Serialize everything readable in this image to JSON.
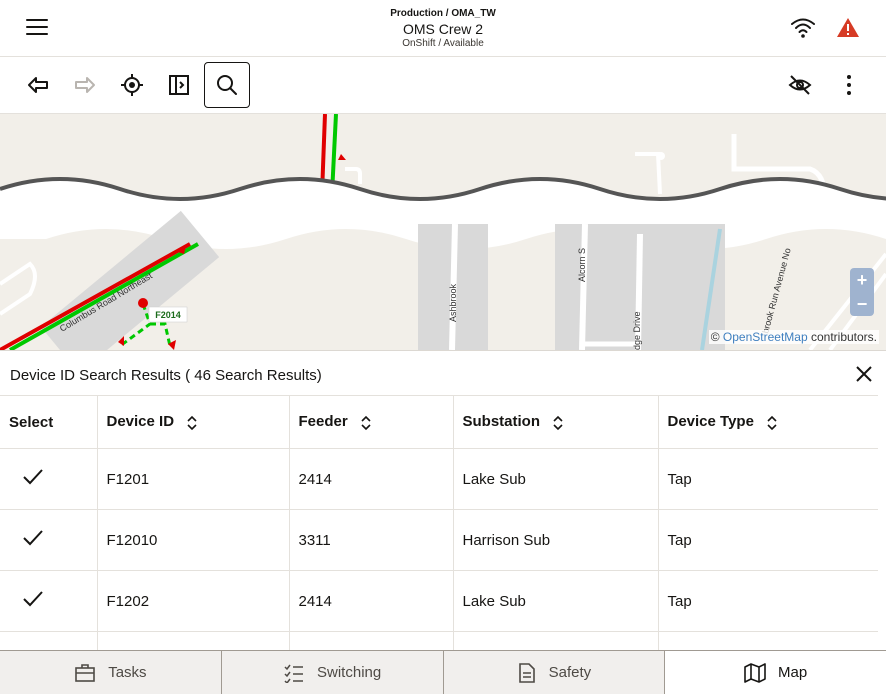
{
  "header": {
    "environment": "Production / OMA_TW",
    "crew": "OMS Crew 2",
    "status": "OnShift / Available"
  },
  "toolbar": {
    "back": "back-icon",
    "forward": "forward-icon",
    "locate": "locate-icon",
    "panel": "panel-icon",
    "search": "search-icon",
    "visibility": "eye-off-icon",
    "more": "more-icon"
  },
  "map": {
    "street_labels": [
      "Columbus Road Northeast",
      "Ashbrook",
      "Alcorn S",
      "dge Drive",
      "brook Run Avenue No"
    ],
    "device_label": "F2014",
    "zoom_in": "+",
    "zoom_out": "−",
    "attribution_prefix": "©",
    "attribution_link": "OpenStreetMap",
    "attribution_suffix": "contributors."
  },
  "results": {
    "title": "Device ID Search Results ( 46 Search Results)",
    "columns": [
      "Select",
      "Device ID",
      "Feeder",
      "Substation",
      "Device Type"
    ],
    "rows": [
      {
        "device_id": "F1201",
        "feeder": "2414",
        "substation": "Lake Sub",
        "device_type": "Tap"
      },
      {
        "device_id": "F12010",
        "feeder": "3311",
        "substation": "Harrison Sub",
        "device_type": "Tap"
      },
      {
        "device_id": "F1202",
        "feeder": "2414",
        "substation": "Lake Sub",
        "device_type": "Tap"
      }
    ]
  },
  "tabs": [
    {
      "label": "Tasks",
      "icon": "briefcase-icon"
    },
    {
      "label": "Switching",
      "icon": "checklist-icon"
    },
    {
      "label": "Safety",
      "icon": "document-icon"
    },
    {
      "label": "Map",
      "icon": "map-icon"
    }
  ],
  "colors": {
    "accent": "#161513",
    "warning": "#d63b25",
    "energized": "#00c800",
    "deenergized": "#e00000"
  }
}
